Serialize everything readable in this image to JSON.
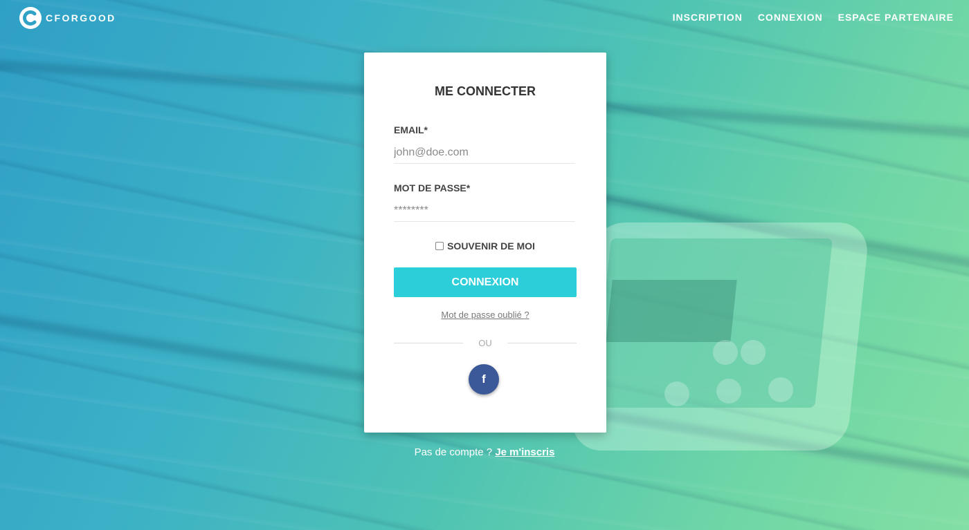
{
  "header": {
    "logo_text": "CFORGOOD",
    "nav": [
      {
        "label": "INSCRIPTION"
      },
      {
        "label": "CONNEXION"
      },
      {
        "label": "ESPACE PARTENAIRE"
      }
    ]
  },
  "login_card": {
    "title": "ME CONNECTER",
    "email": {
      "label": "EMAIL*",
      "placeholder": "john@doe.com"
    },
    "password": {
      "label": "MOT DE PASSE*",
      "placeholder": "********"
    },
    "remember_label": "SOUVENIR DE MOI",
    "remember_checked": false,
    "submit_label": "CONNEXION",
    "forgot_link": "Mot de passe oublié ?",
    "divider_text": "OU",
    "facebook_icon": "facebook-icon",
    "facebook_glyph": "f"
  },
  "footer": {
    "no_account_text": "Pas de compte ?",
    "signup_link": "Je m'inscris"
  },
  "colors": {
    "accent_button": "#2ccfd9",
    "facebook": "#3b5998",
    "background_start": "#2f9fc6",
    "background_end": "#83dfa3"
  }
}
